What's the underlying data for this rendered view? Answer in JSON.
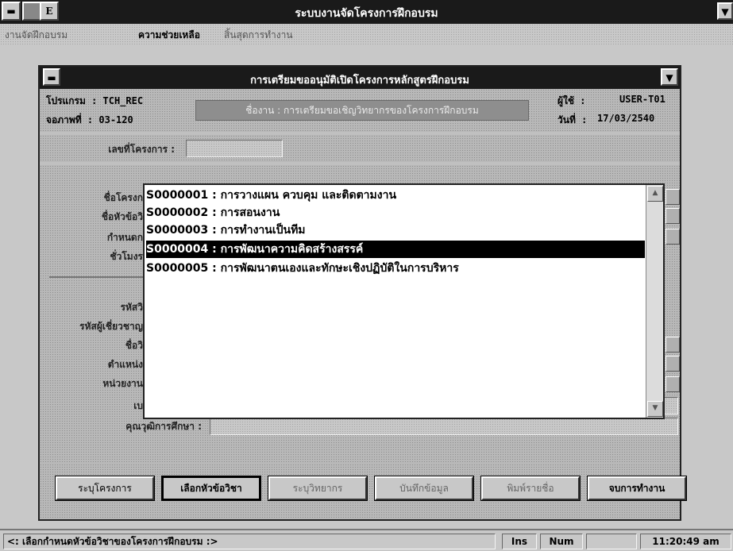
{
  "app": {
    "title": "ระบบงานจัดโครงการฝึกอบรม"
  },
  "menu": {
    "items": [
      {
        "label": "งานจัดฝึกอบรม"
      },
      {
        "label": "ความช่วยเหลือ"
      },
      {
        "label": "สิ้นสุดการทำงาน"
      }
    ]
  },
  "window": {
    "title": "การเตรียมขออนุมัติเปิดโครงการหลักสูตรฝึกอบรม",
    "program_label": "โปรแกรม : TCH_REC",
    "screen_label": "จอภาพที่ : 03-120",
    "task": "ชื่องาน : การเตรียมขอเชิญวิทยากรของโครงการฝึกอบรม",
    "user_label": "ผู้ใช้ :",
    "user_value": "USER-T01",
    "date_label": "วันที่ :",
    "date_value": "17/03/2540"
  },
  "form": {
    "project_no_label": "เลขที่โครงการ :",
    "project_name_label": "ชื่อโครงก",
    "course_name_label": "ชื่อหัวข้อวิ",
    "schedule_label": "กำหนดก",
    "hours_label": "ชั่วโมงร",
    "code_label": "รหัสวิ",
    "expert_code_label": "รหัสผู้เชี่ยวชาญ",
    "name_label": "ชื่อวิ",
    "position_label": "ตำแหน่ง",
    "agency_label": "หน่วยงาน",
    "phone_label": "เบอร์โทรติดต่อ :",
    "education_label": "คุณวุฒิการศึกษา :"
  },
  "list": {
    "items": [
      "S0000001 : การวางแผน ควบคุม และติดตามงาน",
      "S0000002 : การสอนงาน",
      "S0000003 : การทำงานเป็นทีม",
      "S0000004 : การพัฒนาความคิดสร้างสรรค์",
      "S0000005 : การพัฒนาตนเองและทักษะเชิงปฏิบัติในการบริหาร"
    ],
    "selected_index": 3
  },
  "buttons": {
    "specify_project": "ระบุโครงการ",
    "select_course": "เลือกหัวข้อวิชา",
    "specify_speaker": "ระบุวิทยากร",
    "save": "บันทึกข้อมูล",
    "print": "พิมพ์รายชื่อ",
    "exit": "จบการทำงาน"
  },
  "status": {
    "message": "<: เลือกกำหนดหัวข้อวิชาของโครงการฝึกอบรม :>",
    "ins": "Ins",
    "num": "Num",
    "time": "11:20:49 am"
  },
  "icons": {
    "system_menu": "system-menu-icon",
    "scroll_up": "scroll-up-icon",
    "scroll_down": "scroll-down-icon",
    "dropdown": "dropdown-icon"
  }
}
